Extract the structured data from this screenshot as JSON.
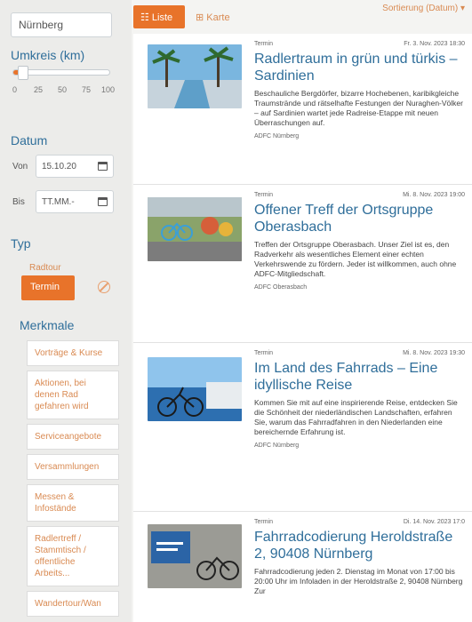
{
  "sidebar": {
    "location_value": "Nürnberg",
    "radius_heading": "Umkreis (km)",
    "radius_ticks": [
      "0",
      "25",
      "50",
      "75",
      "100"
    ],
    "radius_value_km": 5,
    "date_heading": "Datum",
    "from_label": "Von",
    "from_value": "15.10.20",
    "to_label": "Bis",
    "to_value": "TT.MM.-",
    "type_heading": "Typ",
    "type_options": [
      "Radtour",
      "Termin"
    ],
    "type_selected": "Termin",
    "features_heading": "Merkmale",
    "features": [
      "Vorträge & Kurse",
      "Aktionen, bei denen Rad gefahren wird",
      "Serviceangebote",
      "Versammlungen",
      "Messen & Infostände",
      "Radlertreff / Stammtisch / offentliche Arbeits...",
      "Wandertour/Wan"
    ]
  },
  "toolbar": {
    "list_label": "Liste",
    "map_label": "Karte",
    "sort_label": "Sortierung (Datum)"
  },
  "events": [
    {
      "type": "Termin",
      "date": "Fr. 3. Nov. 2023 18:30",
      "title": "Radlertraum in grün und türkis – Sardinien",
      "description": "Beschauliche Bergdörfer, bizarre Hochebenen, karibikgleiche Traumstrände und rätselhafte Festungen der Nuraghen-Völker – auf Sardinien wartet jede Radreise-Etappe mit neuen Überraschungen auf.",
      "organizer": "ADFC Nürnberg"
    },
    {
      "type": "Termin",
      "date": "Mi. 8. Nov. 2023 19:00",
      "title": "Offener Treff der Ortsgruppe Oberasbach",
      "description": "Treffen der Ortsgruppe Oberasbach. Unser Ziel ist es, den Radverkehr als wesentliches Element einer echten Verkehrswende zu fördern. Jeder ist willkommen, auch ohne ADFC-Mitgliedschaft.",
      "organizer": "ADFC Oberasbach"
    },
    {
      "type": "Termin",
      "date": "Mi. 8. Nov. 2023 19:30",
      "title": "Im Land des Fahrrads – Eine idyllische Reise",
      "description": "Kommen Sie mit auf eine inspirierende Reise, entdecken Sie die Schönheit der niederländischen Landschaften, erfahren Sie, warum das Fahrradfahren in den Niederlanden eine bereichernde Erfahrung ist.",
      "organizer": "ADFC Nürnberg"
    },
    {
      "type": "Termin",
      "date": "Di. 14. Nov. 2023 17:0",
      "title": "Fahrradcodierung Heroldstraße 2, 90408 Nürnberg",
      "description": "Fahrradcodierung jeden 2. Dienstag im Monat von 17:00 bis 20:00 Uhr im Infoladen in der Heroldstraße 2, 90408 Nürnberg Zur",
      "organizer": ""
    }
  ],
  "colors": {
    "accent": "#e8732a",
    "link": "#2f6e9a",
    "soft_orange": "#d98a52"
  }
}
